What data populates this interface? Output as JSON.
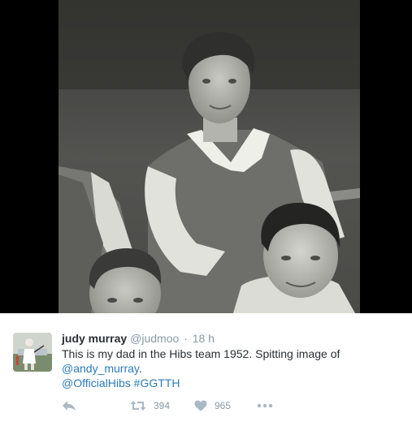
{
  "tweet": {
    "author": {
      "display_name": "judy murray",
      "handle": "@judmoo"
    },
    "separator": "·",
    "timestamp": "18 h",
    "text": {
      "line1": "This is my dad in the Hibs team 1952. Spitting image of",
      "mention_andy": "@andy_murray",
      "after_mention": ".",
      "mention_hibs": "@OfficialHibs",
      "hashtag": "#GGTTH"
    },
    "actions": {
      "reply_icon": "reply-icon",
      "retweet_icon": "retweet-icon",
      "retweet_count": "394",
      "like_icon": "heart-icon",
      "like_count": "965",
      "more_icon": "more-dots-icon"
    }
  },
  "colors": {
    "name": "#292f33",
    "secondary": "#8899a6",
    "link": "#2b7bb9",
    "action_icon": "#aab8c2"
  }
}
